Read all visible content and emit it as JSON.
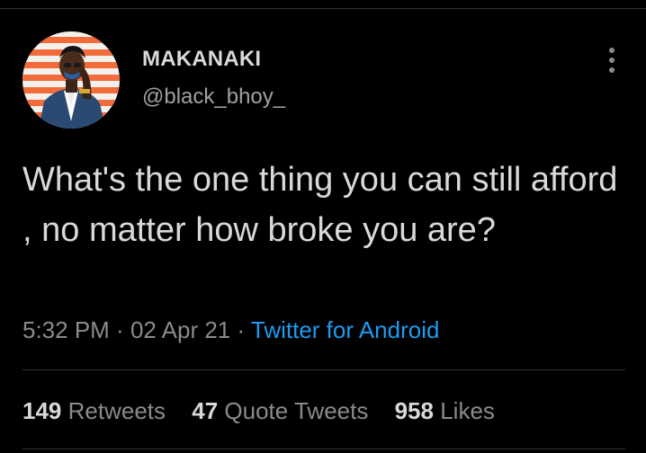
{
  "author": {
    "display_name": "MAKANAKI",
    "handle": "@black_bhoy_"
  },
  "icons": {
    "menu": "more-vertical-icon",
    "avatar": "avatar"
  },
  "tweet": {
    "text": "What's the one thing you can still afford , no matter how broke you are?",
    "time": "5:32 PM",
    "date": "02 Apr 21",
    "separator": " · ",
    "source": "Twitter for Android"
  },
  "stats": [
    {
      "count": "149",
      "label": "Retweets"
    },
    {
      "count": "47",
      "label": "Quote Tweets"
    },
    {
      "count": "958",
      "label": "Likes"
    }
  ],
  "colors": {
    "background": "#000000",
    "text_primary": "#d9d9d9",
    "text_secondary": "#8b8b8b",
    "link": "#1d9bf0",
    "divider": "#2f3336"
  }
}
